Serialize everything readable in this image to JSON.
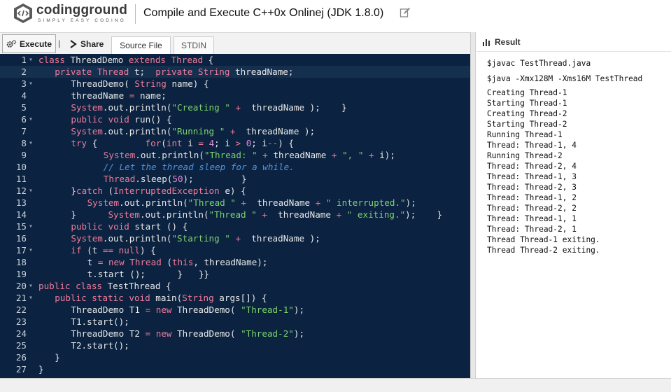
{
  "header": {
    "logo_text": "codingground",
    "logo_tagline": "SIMPLY EASY CODING",
    "title": "Compile and Execute C++0x Onlinej (JDK 1.8.0)"
  },
  "toolbar": {
    "execute_label": "Execute",
    "share_label": "Share",
    "tabs": [
      {
        "label": "Source File",
        "active": true
      },
      {
        "label": "STDIN",
        "active": false
      }
    ]
  },
  "editor": {
    "lines": [
      {
        "n": "1",
        "fold": true,
        "indent": 0,
        "html": "<span class=\"kw\">class</span> ThreadDemo <span class=\"kw\">extends</span> <span class=\"ty\">Thread</span> {"
      },
      {
        "n": "2",
        "fold": false,
        "indent": 1,
        "active": true,
        "html": "<span class=\"kw\">private</span> <span class=\"ty\">Thread</span> t;  <span class=\"kw\">private</span> <span class=\"ty\">String</span> threadName;"
      },
      {
        "n": "3",
        "fold": true,
        "indent": 2,
        "html": "ThreadDemo( <span class=\"ty\">String</span> name) {"
      },
      {
        "n": "4",
        "fold": false,
        "indent": 2,
        "html": "threadName <span class=\"op\">=</span> name;"
      },
      {
        "n": "5",
        "fold": false,
        "indent": 2,
        "html": "<span class=\"ty\">System</span>.out.println(<span class=\"str\">\"Creating \"</span> <span class=\"op\">+</span>  threadName );    }"
      },
      {
        "n": "6",
        "fold": true,
        "indent": 2,
        "html": "<span class=\"kw\">public</span> <span class=\"kw\">void</span> run() {"
      },
      {
        "n": "7",
        "fold": false,
        "indent": 2,
        "html": "<span class=\"ty\">System</span>.out.println(<span class=\"str\">\"Running \"</span> <span class=\"op\">+</span>  threadName );"
      },
      {
        "n": "8",
        "fold": true,
        "indent": 2,
        "html": "<span class=\"kw\">try</span> {         <span class=\"kw\">for</span>(<span class=\"kw\">int</span> i <span class=\"op\">=</span> <span class=\"num\">4</span>; i <span class=\"op\">&gt;</span> <span class=\"num\">0</span>; i<span class=\"op\">--</span>) {"
      },
      {
        "n": "9",
        "fold": false,
        "indent": 4,
        "html": "<span class=\"ty\">System</span>.out.println(<span class=\"str\">\"Thread: \"</span> <span class=\"op\">+</span> threadName <span class=\"op\">+</span> <span class=\"str\">\", \"</span> <span class=\"op\">+</span> i);"
      },
      {
        "n": "10",
        "fold": false,
        "indent": 4,
        "html": "<span class=\"cm\">// Let the thread sleep for a while.</span>"
      },
      {
        "n": "11",
        "fold": false,
        "indent": 4,
        "html": "<span class=\"ty\">Thread</span>.sleep(<span class=\"num\">50</span>);         }"
      },
      {
        "n": "12",
        "fold": true,
        "indent": 2,
        "html": "}<span class=\"kw\">catch</span> (<span class=\"ty\">InterruptedException</span> e) {"
      },
      {
        "n": "13",
        "fold": false,
        "indent": 3,
        "html": "<span class=\"ty\">System</span>.out.println(<span class=\"str\">\"Thread \"</span> <span class=\"op\">+</span>  threadName <span class=\"op\">+</span> <span class=\"str\">\" interrupted.\"</span>);"
      },
      {
        "n": "14",
        "fold": false,
        "indent": 2,
        "html": "}      <span class=\"ty\">System</span>.out.println(<span class=\"str\">\"Thread \"</span> <span class=\"op\">+</span>  threadName <span class=\"op\">+</span> <span class=\"str\">\" exiting.\"</span>);    }"
      },
      {
        "n": "15",
        "fold": true,
        "indent": 2,
        "html": "<span class=\"kw\">public</span> <span class=\"kw\">void</span> start () {"
      },
      {
        "n": "16",
        "fold": false,
        "indent": 2,
        "html": "<span class=\"ty\">System</span>.out.println(<span class=\"str\">\"Starting \"</span> <span class=\"op\">+</span>  threadName );"
      },
      {
        "n": "17",
        "fold": true,
        "indent": 2,
        "html": "<span class=\"kw\">if</span> (t <span class=\"op\">==</span> <span class=\"kw\">null</span>) {"
      },
      {
        "n": "18",
        "fold": false,
        "indent": 3,
        "html": "t <span class=\"op\">=</span> <span class=\"kw\">new</span> <span class=\"ty\">Thread</span> (<span class=\"kw\">this</span>, threadName);"
      },
      {
        "n": "19",
        "fold": false,
        "indent": 3,
        "html": "t.start ();      }   }}"
      },
      {
        "n": "20",
        "fold": true,
        "indent": 0,
        "html": "<span class=\"kw\">public</span> <span class=\"kw\">class</span> TestThread {"
      },
      {
        "n": "21",
        "fold": true,
        "indent": 1,
        "html": "<span class=\"kw\">public</span> <span class=\"kw\">static</span> <span class=\"kw\">void</span> main(<span class=\"ty\">String</span> args[]) {"
      },
      {
        "n": "22",
        "fold": false,
        "indent": 2,
        "html": "ThreadDemo T1 <span class=\"op\">=</span> <span class=\"kw\">new</span> ThreadDemo( <span class=\"str\">\"Thread-1\"</span>);"
      },
      {
        "n": "23",
        "fold": false,
        "indent": 2,
        "html": "T1.start();"
      },
      {
        "n": "24",
        "fold": false,
        "indent": 2,
        "html": "ThreadDemo T2 <span class=\"op\">=</span> <span class=\"kw\">new</span> ThreadDemo( <span class=\"str\">\"Thread-2\"</span>);"
      },
      {
        "n": "25",
        "fold": false,
        "indent": 2,
        "html": "T2.start();"
      },
      {
        "n": "26",
        "fold": false,
        "indent": 1,
        "html": "}"
      },
      {
        "n": "27",
        "fold": false,
        "indent": 0,
        "html": "}"
      }
    ]
  },
  "result": {
    "label": "Result",
    "commands": [
      "$javac TestThread.java",
      "$java -Xmx128M -Xms16M TestThread"
    ],
    "output": [
      "Creating Thread-1",
      "Starting Thread-1",
      "Creating Thread-2",
      "Starting Thread-2",
      "Running Thread-1",
      "Thread: Thread-1, 4",
      "Running Thread-2",
      "Thread: Thread-2, 4",
      "Thread: Thread-1, 3",
      "Thread: Thread-2, 3",
      "Thread: Thread-1, 2",
      "Thread: Thread-2, 2",
      "Thread: Thread-1, 1",
      "Thread: Thread-2, 1",
      "Thread Thread-1 exiting.",
      "Thread Thread-2 exiting."
    ]
  },
  "colors": {
    "editor_bg": "#0b2340",
    "keyword": "#f07a9a",
    "string": "#7ed26e",
    "number": "#e08bd8",
    "comment": "#4f93e0"
  },
  "icons": [
    "codingground-logo-icon",
    "edit-icon",
    "gear-icon",
    "share-arrow-icon",
    "bar-chart-icon"
  ]
}
